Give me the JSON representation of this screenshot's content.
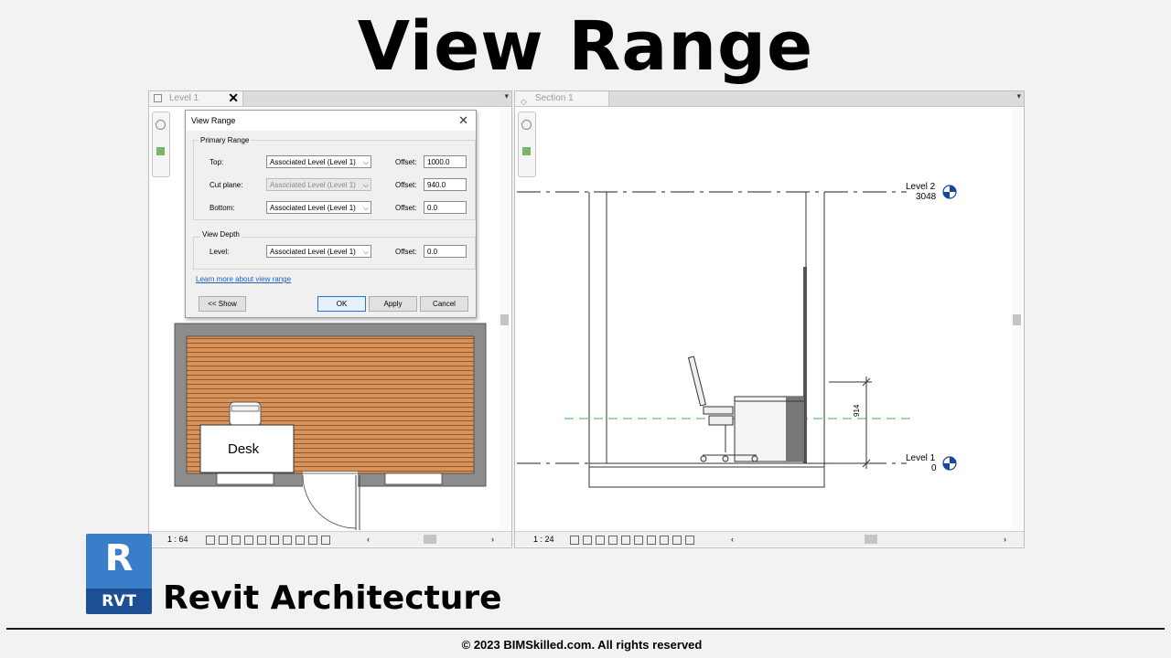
{
  "page": {
    "title": "View Range"
  },
  "left_view": {
    "tab_label": "Level 1",
    "scale": "1 : 64",
    "desk_label": "Desk"
  },
  "right_view": {
    "tab_label": "Section 1",
    "scale": "1 : 24",
    "level2": {
      "name": "Level 2",
      "elevation": "3048"
    },
    "level1": {
      "name": "Level 1",
      "elevation": "0"
    },
    "dimension": "914"
  },
  "dialog": {
    "title": "View Range",
    "primary_range": {
      "label": "Primary Range",
      "rows": [
        {
          "label": "Top:",
          "combo": "Associated Level (Level 1)",
          "offset_label": "Offset:",
          "offset": "1000.0",
          "disabled": false
        },
        {
          "label": "Cut plane:",
          "combo": "Associated Level (Level 1)",
          "offset_label": "Offset:",
          "offset": "940.0",
          "disabled": true
        },
        {
          "label": "Bottom:",
          "combo": "Associated Level (Level 1)",
          "offset_label": "Offset:",
          "offset": "0.0",
          "disabled": false
        }
      ]
    },
    "view_depth": {
      "label": "View Depth",
      "level_label": "Level:",
      "combo": "Associated Level (Level 1)",
      "offset_label": "Offset:",
      "offset": "0.0"
    },
    "link": "Learn more about view range",
    "buttons": {
      "show": "<< Show",
      "ok": "OK",
      "apply": "Apply",
      "cancel": "Cancel"
    }
  },
  "brand": {
    "logo_letter": "R",
    "logo_abbr": "RVT",
    "name": "Revit Architecture"
  },
  "footer": {
    "copyright": "© 2023 BIMSkilled.com. All rights reserved"
  },
  "colors": {
    "accent_blue": "#1e5ba8",
    "wood": "#d9935a",
    "cut_plane": "#3cb54a",
    "level_marker": "#1546a0"
  }
}
